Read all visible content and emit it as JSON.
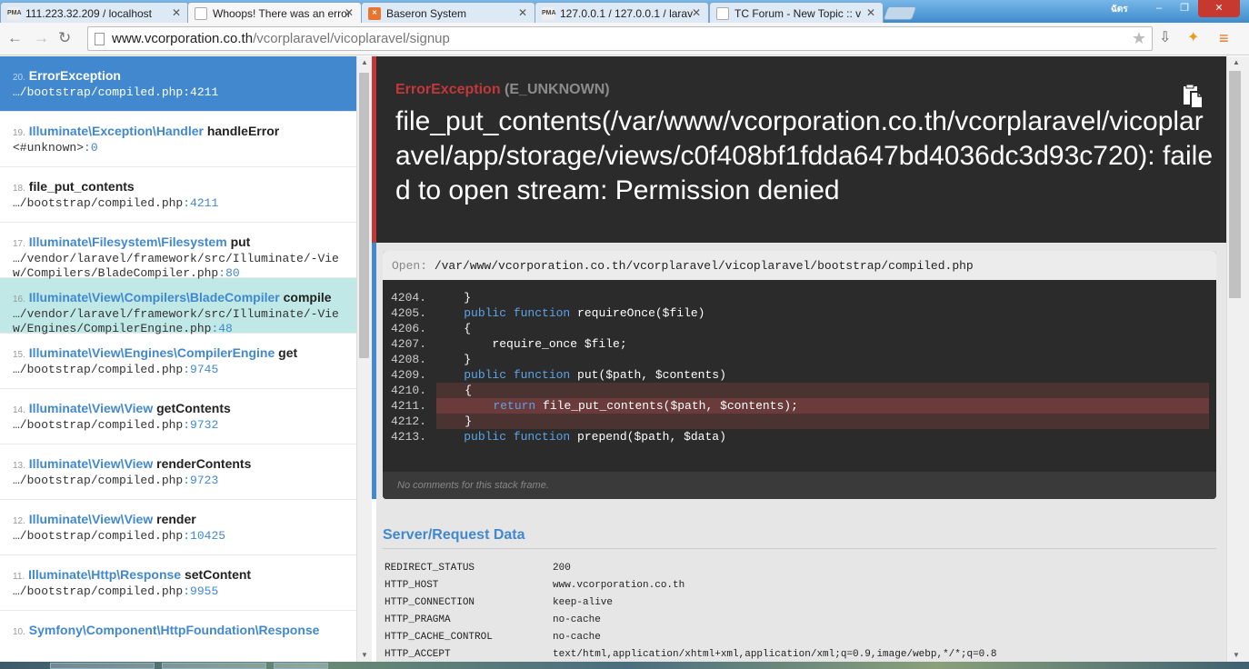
{
  "tabs": [
    {
      "label": "111.223.32.209 / localhost",
      "icon": "PMA"
    },
    {
      "label": "Whoops! There was an error",
      "icon": "page"
    },
    {
      "label": "Baseron System",
      "icon": "xampp"
    },
    {
      "label": "127.0.0.1 / 127.0.0.1 / larav",
      "icon": "PMA"
    },
    {
      "label": "TC Forum - New Topic :: v",
      "icon": "page"
    }
  ],
  "window": {
    "user_label": "ฉัตร",
    "minimize": "–",
    "maximize": "❐",
    "close": "✕"
  },
  "address": {
    "host": "www.vcorporation.co.th",
    "path": "/vcorplaravel/vicoplaravel/signup"
  },
  "frames": [
    {
      "num": "20.",
      "cls": "ErrorException",
      "method": "",
      "path": "…/bootstrap/compiled.php",
      "line": "4211",
      "state": "active"
    },
    {
      "num": "19.",
      "cls": "Illuminate\\Exception\\Handler",
      "method": "handleError",
      "path": "<#unknown>",
      "line": "0",
      "state": ""
    },
    {
      "num": "18.",
      "cls": "",
      "method": "file_put_contents",
      "path": "…/bootstrap/compiled.php",
      "line": "4211",
      "state": ""
    },
    {
      "num": "17.",
      "cls": "Illuminate\\Filesystem\\Filesystem",
      "method": "put",
      "path": "…/vendor/laravel/framework/src/Illuminate/-View/Compilers/BladeCompiler.php",
      "line": "80",
      "state": ""
    },
    {
      "num": "16.",
      "cls": "Illuminate\\View\\Compilers\\BladeCompiler",
      "method": "compile",
      "path": "…/vendor/laravel/framework/src/Illuminate/-View/Engines/CompilerEngine.php",
      "line": "48",
      "state": "hl"
    },
    {
      "num": "15.",
      "cls": "Illuminate\\View\\Engines\\CompilerEngine",
      "method": "get",
      "path": "…/bootstrap/compiled.php",
      "line": "9745",
      "state": ""
    },
    {
      "num": "14.",
      "cls": "Illuminate\\View\\View",
      "method": "getContents",
      "path": "…/bootstrap/compiled.php",
      "line": "9732",
      "state": ""
    },
    {
      "num": "13.",
      "cls": "Illuminate\\View\\View",
      "method": "renderContents",
      "path": "…/bootstrap/compiled.php",
      "line": "9723",
      "state": ""
    },
    {
      "num": "12.",
      "cls": "Illuminate\\View\\View",
      "method": "render",
      "path": "…/bootstrap/compiled.php",
      "line": "10425",
      "state": ""
    },
    {
      "num": "11.",
      "cls": "Illuminate\\Http\\Response",
      "method": "setContent",
      "path": "…/bootstrap/compiled.php",
      "line": "9955",
      "state": ""
    },
    {
      "num": "10.",
      "cls": "Symfony\\Component\\HttpFoundation\\Response",
      "method": "",
      "path": "",
      "line": "",
      "state": ""
    }
  ],
  "exception": {
    "class": "ErrorException",
    "code": "(E_UNKNOWN)",
    "message": "file_put_contents(/var/www/vcorporation.co.th/vcorplaravel/vicoplaravel/app/storage/views/c0f408bf1fdda647bd4036dc3d93c720): failed to open stream: Permission denied"
  },
  "code": {
    "open_label": "Open:",
    "file": "/var/www/vcorporation.co.th/vcorplaravel/vicoplaravel/bootstrap/compiled.php",
    "lines": [
      {
        "n": "4204.",
        "pre": "    }",
        "kw": "",
        "post": "",
        "hl": ""
      },
      {
        "n": "4205.",
        "pre": "    ",
        "kw": "public function",
        "post": " requireOnce($file)",
        "hl": ""
      },
      {
        "n": "4206.",
        "pre": "    {",
        "kw": "",
        "post": "",
        "hl": ""
      },
      {
        "n": "4207.",
        "pre": "        require_once $file;",
        "kw": "",
        "post": "",
        "hl": ""
      },
      {
        "n": "4208.",
        "pre": "    }",
        "kw": "",
        "post": "",
        "hl": ""
      },
      {
        "n": "4209.",
        "pre": "    ",
        "kw": "public function",
        "post": " put($path, $contents)",
        "hl": ""
      },
      {
        "n": "4210.",
        "pre": "    {",
        "kw": "",
        "post": "",
        "hl": "hl"
      },
      {
        "n": "4211.",
        "pre": "        ",
        "kw": "return",
        "post": " file_put_contents($path, $contents);",
        "hl": "hlstrong"
      },
      {
        "n": "4212.",
        "pre": "    }",
        "kw": "",
        "post": "",
        "hl": "hl"
      },
      {
        "n": "4213.",
        "pre": "    ",
        "kw": "public function",
        "post": " prepend($path, $data)",
        "hl": ""
      }
    ],
    "comments": "No comments for this stack frame."
  },
  "server": {
    "title": "Server/Request Data",
    "rows": [
      {
        "k": "REDIRECT_STATUS",
        "v": "200"
      },
      {
        "k": "HTTP_HOST",
        "v": "www.vcorporation.co.th"
      },
      {
        "k": "HTTP_CONNECTION",
        "v": "keep-alive"
      },
      {
        "k": "HTTP_PRAGMA",
        "v": "no-cache"
      },
      {
        "k": "HTTP_CACHE_CONTROL",
        "v": "no-cache"
      },
      {
        "k": "HTTP_ACCEPT",
        "v": "text/html,application/xhtml+xml,application/xml;q=0.9,image/webp,*/*;q=0.8"
      }
    ]
  }
}
